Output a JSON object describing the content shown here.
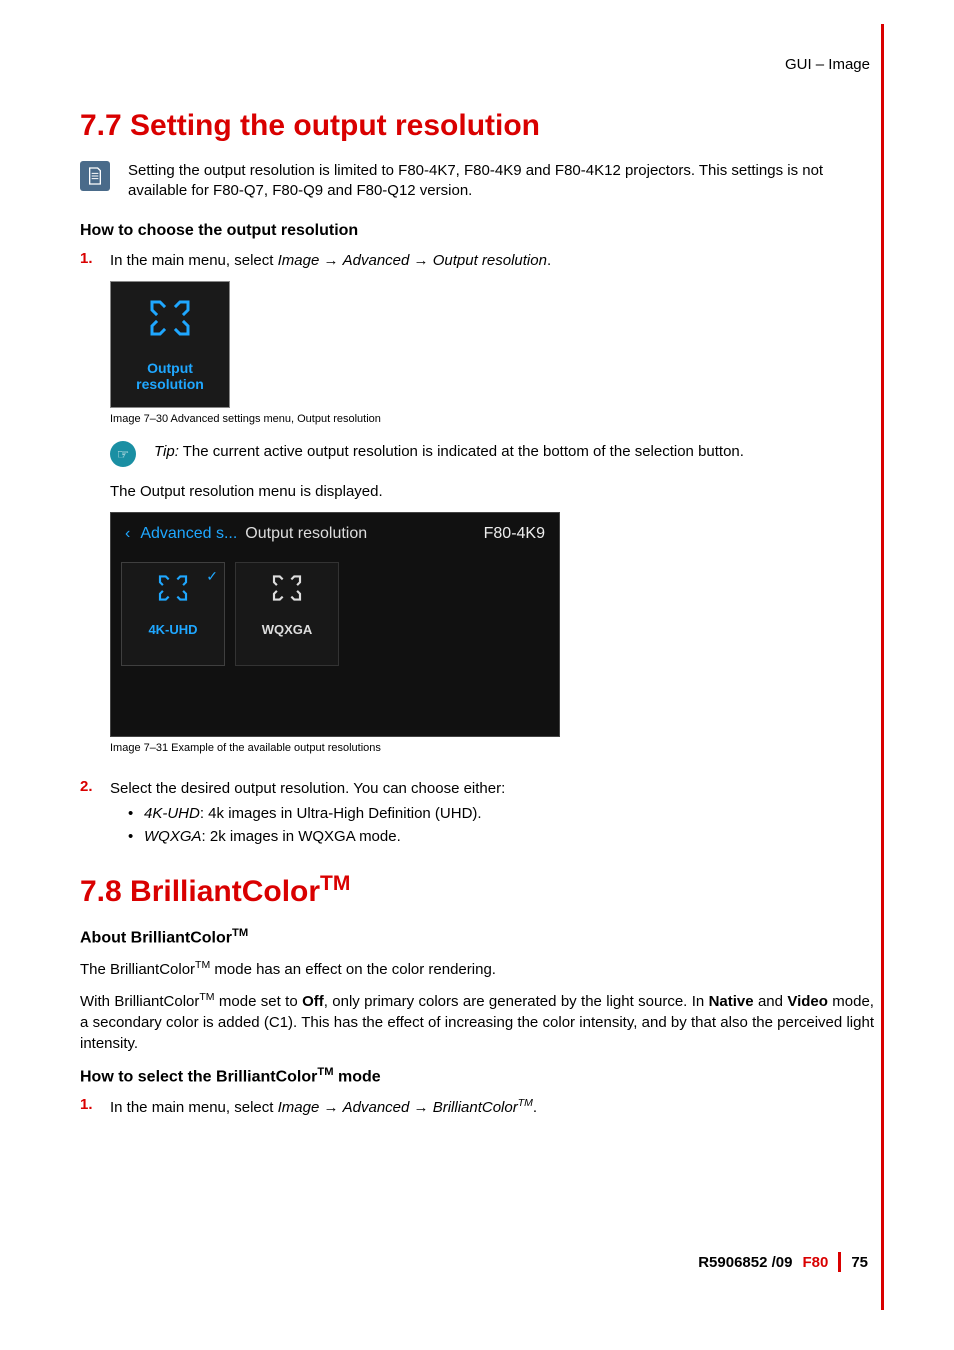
{
  "header": {
    "breadcrumb": "GUI – Image"
  },
  "section1": {
    "title": "7.7 Setting the output resolution",
    "note_icon": "page-icon",
    "note_text": "Setting the output resolution is limited to F80-4K7, F80-4K9 and F80-4K12 projectors. This settings is not available for F80-Q7, F80-Q9 and F80-Q12 version.",
    "sub1": "How to choose the output resolution",
    "step1_num": "1.",
    "step1_pre": "In the main menu, select ",
    "step1_path": [
      "Image",
      "Advanced",
      "Output resolution"
    ],
    "step1_post": ".",
    "tile1_label_l1": "Output",
    "tile1_label_l2": "resolution",
    "caption1": "Image 7–30  Advanced settings menu, Output resolution",
    "tip_icon": "hand-point-icon",
    "tip_lead": "Tip:",
    "tip_text": " The current active output resolution is indicated at the bottom of the selection button.",
    "mid_text": "The Output resolution menu is displayed.",
    "screen2": {
      "back_icon": "chevron-left-icon",
      "breadcrumb": "Advanced s...",
      "title": "Output resolution",
      "model": "F80-4K9",
      "tiles": [
        {
          "label": "4K-UHD",
          "selected": true,
          "check_icon": "check-icon"
        },
        {
          "label": "WQXGA",
          "selected": false
        }
      ]
    },
    "caption2": "Image 7–31  Example of the available output resolutions",
    "step2_num": "2.",
    "step2_text": "Select the desired output resolution. You can choose either:",
    "options": [
      {
        "em": "4K-UHD",
        "rest": ": 4k images in Ultra-High Definition (UHD)."
      },
      {
        "em": "WQXGA",
        "rest": ": 2k images in WQXGA mode."
      }
    ]
  },
  "section2": {
    "title_pre": "7.8 BrilliantColor",
    "title_tm": "TM",
    "sub1_pre": "About BrilliantColor",
    "sub1_tm": "TM",
    "p1_a": "The BrilliantColor",
    "p1_b": " mode has an effect on the color rendering.",
    "p2_a": "With BrilliantColor",
    "p2_b": " mode set to ",
    "p2_off": "Off",
    "p2_c": ", only primary colors are generated by the light source. In ",
    "p2_native": "Native",
    "p2_d": " and ",
    "p2_video": "Video",
    "p2_e": " mode, a secondary color is added (C1). This has the effect of increasing the color intensity, and by that also the perceived light intensity.",
    "sub2_pre": "How to select the BrilliantColor",
    "sub2_tm": "TM",
    "sub2_post": " mode",
    "step1_num": "1.",
    "step1_pre": "In the main menu, select ",
    "step1_path_a": "Image",
    "step1_path_b": "Advanced",
    "step1_path_c_pre": "BrilliantColor",
    "step1_path_c_tm": "TM",
    "step1_post": "."
  },
  "footer": {
    "docnum": "R5906852 /09",
    "product": "F80",
    "page": "75"
  }
}
